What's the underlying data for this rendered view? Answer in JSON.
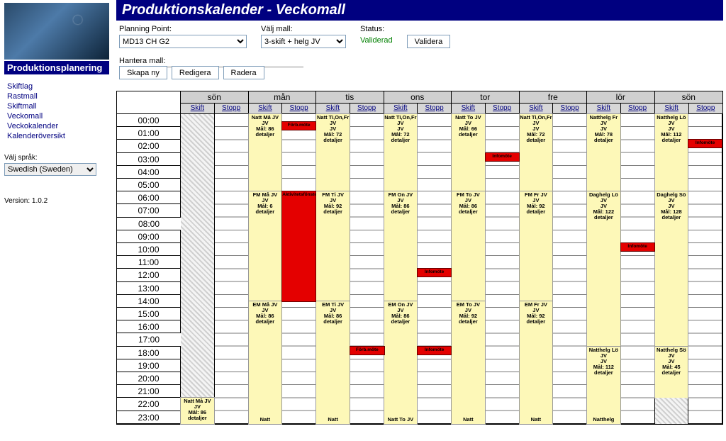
{
  "sidebar": {
    "app_title": "Produktionsplanering",
    "nav": [
      "Skiftlag",
      "Rastmall",
      "Skiftmall",
      "Veckomall",
      "Veckokalender",
      "Kalenderöversikt"
    ],
    "lang_label": "Välj språk:",
    "lang_value": "Swedish (Sweden)",
    "version": "Version: 1.0.2"
  },
  "header": {
    "title": "Produktionskalender - Veckomall",
    "planning_point_label": "Planning Point:",
    "planning_point_value": "MD13 CH G2",
    "mall_label": "Välj mall:",
    "mall_value": "3-skift + helg JV",
    "status_label": "Status:",
    "status_value": "Validerad",
    "validera_btn": "Validera",
    "hantera_label": "Hantera mall:",
    "skapa_btn": "Skapa ny",
    "redigera_btn": "Redigera",
    "radera_btn": "Radera"
  },
  "calendar": {
    "days": [
      "sön",
      "mån",
      "tis",
      "ons",
      "tor",
      "fre",
      "lör",
      "sön"
    ],
    "subheaders": [
      "Skift",
      "Stopp"
    ],
    "hours": [
      "00:00",
      "01:00",
      "02:00",
      "03:00",
      "04:00",
      "05:00",
      "06:00",
      "07:00",
      "08:00",
      "09:00",
      "10:00",
      "11:00",
      "12:00",
      "13:00",
      "14:00",
      "15:00",
      "16:00",
      "17:00",
      "18:00",
      "19:00",
      "20:00",
      "21:00",
      "22:00",
      "23:00"
    ],
    "bottom_labels": [
      "",
      "Natt",
      "Natt",
      "Natt To JV",
      "Natt",
      "Natt",
      "Natthelg",
      "",
      ""
    ]
  },
  "shifts": {
    "d0": [
      {
        "from": 0,
        "to": 22,
        "hatched": true
      },
      {
        "from": 22,
        "to": 24,
        "label": "Natt Må JV",
        "sub": "JV",
        "mal": "Mål: 86",
        "det": "detaljer"
      }
    ],
    "d1": [
      {
        "from": 0,
        "to": 6,
        "label": "Natt Må JV",
        "sub": "JV",
        "mal": "Mål: 86",
        "det": "detaljer"
      },
      {
        "from": 6,
        "to": 14.5,
        "label": "FM Må JV",
        "sub": "JV",
        "mal": "Mål: 6",
        "det": "detaljer"
      },
      {
        "from": 14.5,
        "to": 24,
        "label": "EM Må JV",
        "sub": "JV",
        "mal": "Mål: 86",
        "det": "detaljer"
      }
    ],
    "d2": [
      {
        "from": 0,
        "to": 6,
        "label": "Natt Ti,On,Fr JV",
        "sub": "JV",
        "mal": "Mål: 72",
        "det": "detaljer"
      },
      {
        "from": 6,
        "to": 14.5,
        "label": "FM Ti JV",
        "sub": "JV",
        "mal": "Mål: 92",
        "det": "detaljer"
      },
      {
        "from": 14.5,
        "to": 24,
        "label": "EM Ti JV",
        "sub": "JV",
        "mal": "Mål: 86",
        "det": "detaljer"
      }
    ],
    "d3": [
      {
        "from": 0,
        "to": 6,
        "label": "Natt Ti,On,Fr JV",
        "sub": "JV",
        "mal": "Mål: 72",
        "det": "detaljer"
      },
      {
        "from": 6,
        "to": 14.5,
        "label": "FM On JV",
        "sub": "JV",
        "mal": "Mål: 86",
        "det": "detaljer"
      },
      {
        "from": 14.5,
        "to": 24,
        "label": "EM On JV",
        "sub": "JV",
        "mal": "Mål: 86",
        "det": "detaljer"
      }
    ],
    "d4": [
      {
        "from": 0,
        "to": 6,
        "label": "Natt To JV",
        "sub": "JV",
        "mal": "Mål: 66",
        "det": "detaljer"
      },
      {
        "from": 6,
        "to": 14.5,
        "label": "FM To JV",
        "sub": "JV",
        "mal": "Mål: 86",
        "det": "detaljer"
      },
      {
        "from": 14.5,
        "to": 24,
        "label": "EM To JV",
        "sub": "JV",
        "mal": "Mål: 92",
        "det": "detaljer"
      }
    ],
    "d5": [
      {
        "from": 0,
        "to": 6,
        "label": "Natt Ti,On,Fr JV",
        "sub": "JV",
        "mal": "Mål: 72",
        "det": "detaljer"
      },
      {
        "from": 6,
        "to": 14.5,
        "label": "FM Fr JV",
        "sub": "JV",
        "mal": "Mål: 92",
        "det": "detaljer"
      },
      {
        "from": 14.5,
        "to": 24,
        "label": "EM Fr JV",
        "sub": "JV",
        "mal": "Mål: 92",
        "det": "detaljer"
      }
    ],
    "d6": [
      {
        "from": 0,
        "to": 6,
        "label": "Natthelg Fr JV",
        "sub": "JV",
        "mal": "Mål: 78",
        "det": "detaljer"
      },
      {
        "from": 6,
        "to": 18,
        "label": "Daghelg Lö JV",
        "sub": "JV",
        "mal": "Mål: 122",
        "det": "detaljer"
      },
      {
        "from": 18,
        "to": 24,
        "label": "Natthelg Lö JV",
        "sub": "JV",
        "mal": "Mål: 112",
        "det": "detaljer"
      }
    ],
    "d7": [
      {
        "from": 0,
        "to": 6,
        "label": "Natthelg Lö JV",
        "sub": "JV",
        "mal": "Mål: 112",
        "det": "detaljer"
      },
      {
        "from": 6,
        "to": 18,
        "label": "Daghelg Sö JV",
        "sub": "JV",
        "mal": "Mål: 128",
        "det": "detaljer"
      },
      {
        "from": 18,
        "to": 22,
        "label": "Natthelg Sö JV",
        "sub": "JV",
        "mal": "Mål: 45",
        "det": "detaljer"
      },
      {
        "from": 22,
        "to": 24,
        "hatched": true
      }
    ]
  },
  "stops": {
    "d1": [
      {
        "from": 0.6,
        "to": 1.2,
        "label": "Förb.möte"
      },
      {
        "from": 6,
        "to": 14.5,
        "label": "Aktivitetsfönster"
      }
    ],
    "d2": [
      {
        "from": 18,
        "to": 18.6,
        "label": "Förb.möte"
      }
    ],
    "d3": [
      {
        "from": 12,
        "to": 12.6,
        "label": "Infomöte"
      },
      {
        "from": 18,
        "to": 18.6,
        "label": "Infomöte"
      }
    ],
    "d4": [
      {
        "from": 3,
        "to": 3.6,
        "label": "Infomöte"
      }
    ],
    "d6": [
      {
        "from": 10,
        "to": 10.6,
        "label": "Infomöte"
      }
    ],
    "d7": [
      {
        "from": 2,
        "to": 2.6,
        "label": "Infomöte"
      }
    ]
  }
}
